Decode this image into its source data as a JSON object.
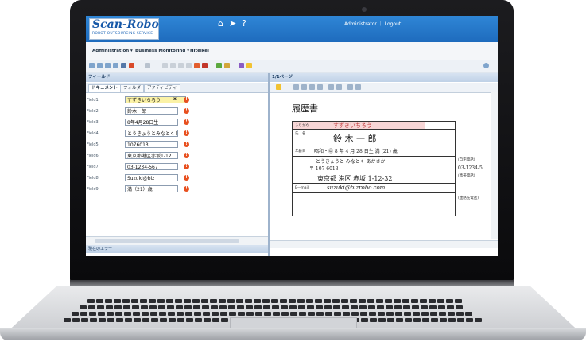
{
  "header": {
    "logo": "Scan-Robo",
    "logo_sub": "ROBOT OUTSOURCING SERVICE",
    "user_links": "Administrator ｜ Logout"
  },
  "menu": [
    {
      "label": "Administration ▾"
    },
    {
      "label": "Business Monitoring ▾"
    },
    {
      "label": "Hitelkei"
    }
  ],
  "left_panel": {
    "title": "フィールド",
    "tabs": [
      "ドキュメント",
      "フォルダ",
      "アクティビティ"
    ],
    "fields": [
      {
        "label": "Field1",
        "value": "すずきいちろう",
        "active": true
      },
      {
        "label": "Field2",
        "value": "鈴木一郎"
      },
      {
        "label": "Field3",
        "value": "8年4月28日生"
      },
      {
        "label": "Field4",
        "value": "とうきょうとみなとくし"
      },
      {
        "label": "Field5",
        "value": "1076013"
      },
      {
        "label": "Field6",
        "value": "東京都港区赤坂1-12"
      },
      {
        "label": "Field7",
        "value": "03-1234-567"
      },
      {
        "label": "Field8",
        "value": "Suzuki@biz"
      },
      {
        "label": "Field9",
        "value": "満（21）歳"
      }
    ],
    "bottom_title": "現在のエラー"
  },
  "right_panel": {
    "title": "1/1ページ",
    "doc": {
      "title": "履歴書",
      "furigana_label": "ふりがな",
      "furigana_value": "すずきいちろう",
      "name_label": "氏　名",
      "name_value": "鈴 木 一 郎",
      "birth_label": "年齢日",
      "birth_value": "昭和・㊥ 8 年 4 月 28 日生 満 (21) 歳",
      "addr_furigana": "とうきょうと みなとく あかさか",
      "postal": "〒 107 6013",
      "address": "東京都 港区 赤坂 1-12-32",
      "email_label": "E—mail",
      "email": "suzuki@bizrobo.com",
      "phone": "03-1234-5",
      "home_label": "(自宅電話)",
      "mobile_label": "(携帯電話)",
      "contact_label": "(連絡先電話)"
    }
  },
  "colors": {
    "header_blue": "#1e6bbd",
    "active_field": "#fbf2a6",
    "error_icon": "#e8501f"
  }
}
